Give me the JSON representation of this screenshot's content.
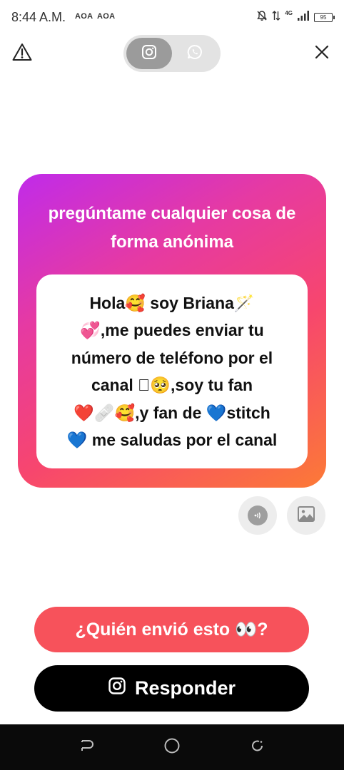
{
  "status_bar": {
    "time": "8:44 A.M.",
    "carrier_1": "AOA",
    "carrier_2": "AOA",
    "network": "4G",
    "battery": "95",
    "icons": [
      "mute-bell-icon",
      "data-arrows-icon",
      "signal-icon",
      "battery-icon"
    ]
  },
  "top_bar": {
    "icons": [
      "warning-icon",
      "instagram-icon",
      "whatsapp-icon",
      "close-icon"
    ],
    "selected_platform": "instagram"
  },
  "card": {
    "title": "pregúntame cualquier cosa de forma anónima",
    "message": "Hola🥰 soy Briana🪄\n💞,me puedes enviar tu\nnúmero de teléfono por el\ncanal 🏻🥺,soy tu fan\n❤️🩹🥰,y fan de 💙stitch\n💙 me saludas por el canal",
    "colors": {
      "gradient_start": "#c02bea",
      "gradient_mid": "#f7466e",
      "gradient_end": "#fc7a36"
    }
  },
  "actions": {
    "icons": [
      "audio-icon",
      "image-icon"
    ]
  },
  "buttons": {
    "who_sent": "¿Quién envió esto 👀?",
    "reply": "Responder",
    "who_sent_color": "#f7525b",
    "reply_color": "#000000"
  },
  "nav_bar": {
    "icons": [
      "back-icon",
      "home-icon",
      "recent-apps-icon"
    ]
  }
}
